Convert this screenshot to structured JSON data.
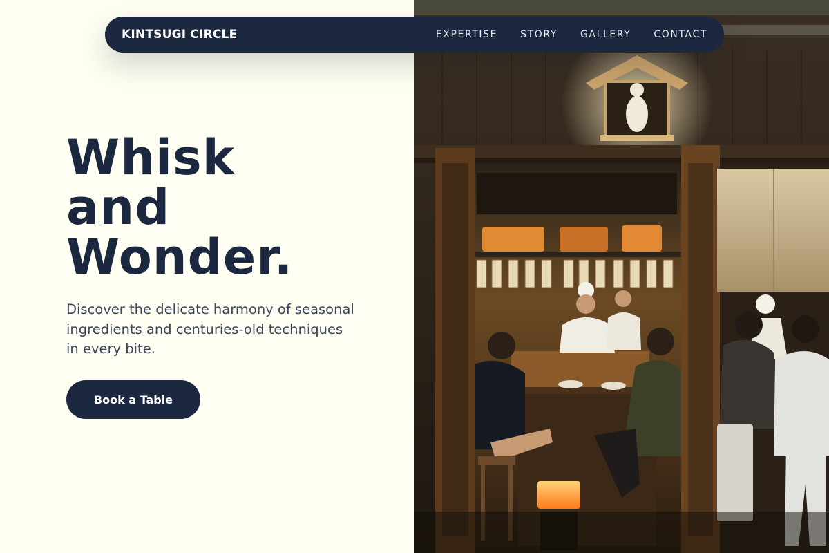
{
  "nav": {
    "brand": "KINTSUGI CIRCLE",
    "links": [
      "EXPERTISE",
      "STORY",
      "GALLERY",
      "CONTACT"
    ]
  },
  "hero": {
    "headline_lines": [
      "Whisk",
      "and",
      "Wonder."
    ],
    "subtext": "Discover the delicate harmony of seasonal ingredients and centuries-old techniques in every bite.",
    "cta_label": "Book a Table",
    "image_alt": "Diners seated at the counter of a warmly lit Japanese izakaya"
  },
  "colors": {
    "navy": "#1c2840",
    "cream_background": "#fefef2",
    "body_text": "#3a4659"
  },
  "icons": []
}
